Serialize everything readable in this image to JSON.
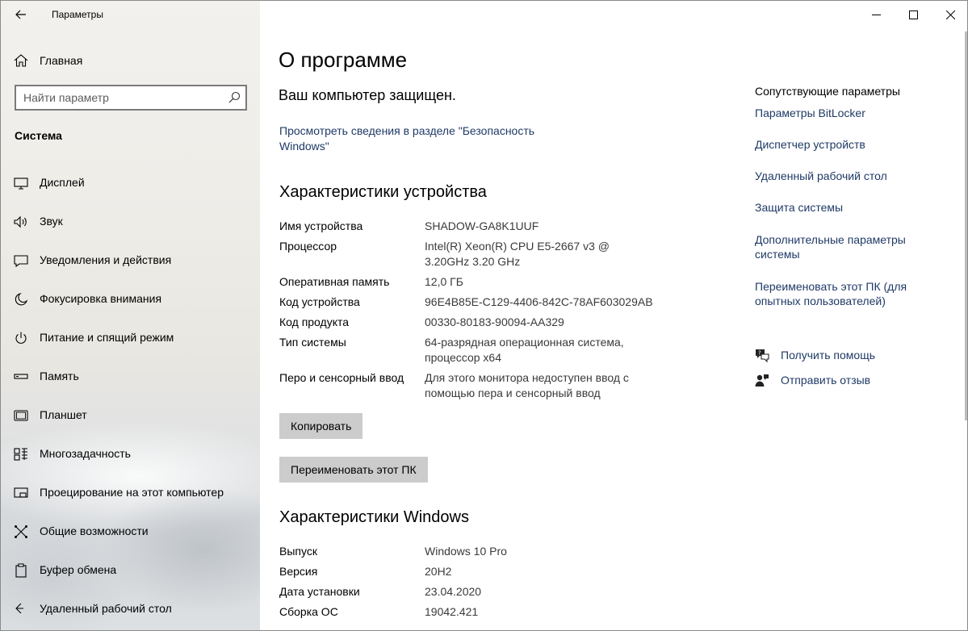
{
  "window": {
    "title": "Параметры"
  },
  "sidebar": {
    "home_label": "Главная",
    "search_placeholder": "Найти параметр",
    "section_title": "Система",
    "items": [
      {
        "label": "Дисплей",
        "icon": "display-icon"
      },
      {
        "label": "Звук",
        "icon": "speaker-icon"
      },
      {
        "label": "Уведомления и действия",
        "icon": "notification-icon"
      },
      {
        "label": "Фокусировка внимания",
        "icon": "moon-icon"
      },
      {
        "label": "Питание и спящий режим",
        "icon": "power-icon"
      },
      {
        "label": "Память",
        "icon": "storage-icon"
      },
      {
        "label": "Планшет",
        "icon": "tablet-icon"
      },
      {
        "label": "Многозадачность",
        "icon": "multitasking-icon"
      },
      {
        "label": "Проецирование на этот компьютер",
        "icon": "projector-icon"
      },
      {
        "label": "Общие возможности",
        "icon": "shared-experiences-icon"
      },
      {
        "label": "Буфер обмена",
        "icon": "clipboard-icon"
      },
      {
        "label": "Удаленный рабочий стол",
        "icon": "remote-desktop-icon"
      }
    ]
  },
  "main": {
    "title": "О программе",
    "protected_text": "Ваш компьютер защищен.",
    "security_link": "Просмотреть сведения в разделе \"Безопасность Windows\"",
    "device_specs": {
      "heading": "Характеристики устройства",
      "rows": [
        {
          "key": "Имя устройства",
          "value": "SHADOW-GA8K1UUF"
        },
        {
          "key": "Процессор",
          "value": "Intel(R) Xeon(R) CPU E5-2667 v3 @ 3.20GHz   3.20 GHz"
        },
        {
          "key": "Оперативная память",
          "value": "12,0 ГБ"
        },
        {
          "key": "Код устройства",
          "value": "96E4B85E-C129-4406-842C-78AF603029AB"
        },
        {
          "key": "Код продукта",
          "value": "00330-80183-90094-AA329"
        },
        {
          "key": "Тип системы",
          "value": "64-разрядная операционная система, процессор x64"
        },
        {
          "key": "Перо и сенсорный ввод",
          "value": "Для этого монитора недоступен ввод с помощью пера и сенсорный ввод"
        }
      ],
      "copy_button": "Копировать",
      "rename_button": "Переименовать этот ПК"
    },
    "windows_specs": {
      "heading": "Характеристики Windows",
      "rows": [
        {
          "key": "Выпуск",
          "value": "Windows 10 Pro"
        },
        {
          "key": "Версия",
          "value": "20H2"
        },
        {
          "key": "Дата установки",
          "value": "23.04.2020"
        },
        {
          "key": "Сборка ОС",
          "value": "19042.421"
        }
      ]
    }
  },
  "related": {
    "heading": "Сопутствующие параметры",
    "links": [
      "Параметры BitLocker",
      "Диспетчер устройств",
      "Удаленный рабочий стол",
      "Защита системы",
      "Дополнительные параметры системы",
      "Переименовать этот ПК (для опытных пользователей)"
    ],
    "get_help": "Получить помощь",
    "feedback": "Отправить отзыв"
  },
  "colors": {
    "link": "#1f3a66",
    "button": "#cccccc"
  }
}
